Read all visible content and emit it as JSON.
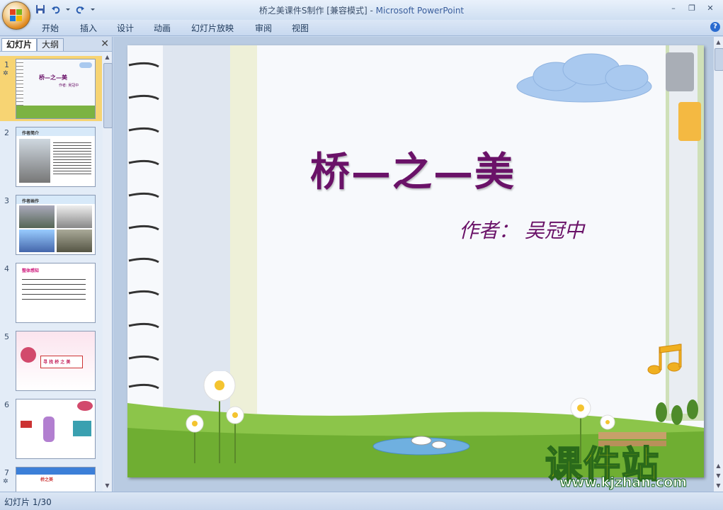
{
  "window": {
    "title_prefix": "桥之美课件S制作 [兼容模式] - ",
    "app_name": "Microsoft PowerPoint",
    "minimize": "–",
    "restore": "❐",
    "close": "✕"
  },
  "ribbon": {
    "tabs": [
      "开始",
      "插入",
      "设计",
      "动画",
      "幻灯片放映",
      "审阅",
      "视图"
    ],
    "help": "?"
  },
  "panel": {
    "tab_slides": "幻灯片",
    "tab_outline": "大纲",
    "close": "✕"
  },
  "thumbnails": [
    {
      "num": "1",
      "badge": "✲",
      "title": "桥—之—美",
      "sub": "作者: 吴冠中"
    },
    {
      "num": "2",
      "badge": "",
      "title": "作者简介"
    },
    {
      "num": "3",
      "badge": "",
      "title": "作者画作"
    },
    {
      "num": "4",
      "badge": "",
      "title": "整体感知"
    },
    {
      "num": "5",
      "badge": "",
      "title": "寻 找 桥 之 美"
    },
    {
      "num": "6",
      "badge": "",
      "title": ""
    },
    {
      "num": "7",
      "badge": "✲",
      "title": "桥之美"
    }
  ],
  "slide": {
    "title": "桥—之—美",
    "author": "作者：  吴冠中"
  },
  "watermark": {
    "cn": "课件站",
    "url": "www.kjzhan.com"
  },
  "status": {
    "slide_counter": "幻灯片 1/30"
  },
  "colors": {
    "title_purple": "#6a1268",
    "selection": "#f7d473",
    "grass": "#7cb342"
  }
}
